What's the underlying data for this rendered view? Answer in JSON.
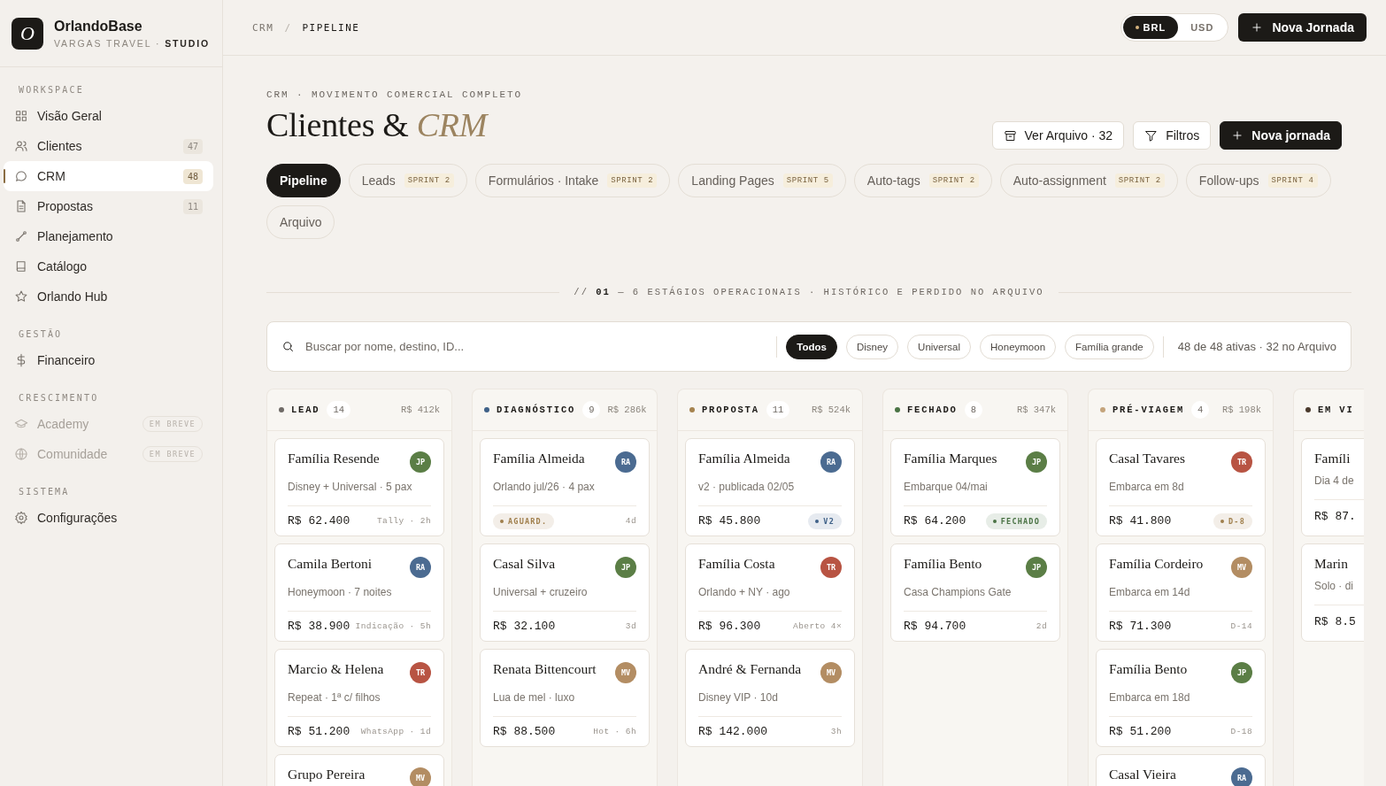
{
  "sidebar": {
    "brand": {
      "logo": "O",
      "name": "OrlandoBase",
      "subtitle": "VARGAS TRAVEL · **STUDIO**"
    },
    "sections": [
      {
        "title": "WORKSPACE",
        "items": [
          {
            "label": "Visão Geral",
            "selected": false,
            "disabled": false
          },
          {
            "label": "Clientes",
            "count": "47",
            "selected": false,
            "disabled": false
          },
          {
            "label": "CRM",
            "count": "48",
            "selected": true,
            "disabled": false
          },
          {
            "label": "Propostas",
            "count": "11",
            "selected": false,
            "disabled": false
          },
          {
            "label": "Planejamento",
            "selected": false,
            "disabled": false
          },
          {
            "label": "Catálogo",
            "selected": false,
            "disabled": false
          },
          {
            "label": "Orlando Hub",
            "selected": false,
            "disabled": false
          }
        ]
      },
      {
        "title": "GESTÃO",
        "items": [
          {
            "label": "Financeiro",
            "selected": false,
            "disabled": false
          }
        ]
      },
      {
        "title": "CRESCIMENTO",
        "items": [
          {
            "label": "Academy",
            "badge": "EM BREVE",
            "selected": false,
            "disabled": true
          },
          {
            "label": "Comunidade",
            "badge": "EM BREVE",
            "selected": false,
            "disabled": true
          }
        ]
      },
      {
        "title": "SISTEMA",
        "items": [
          {
            "label": "Configurações",
            "selected": false,
            "disabled": false
          }
        ]
      }
    ]
  },
  "topbar": {
    "breadcrumb": [
      "CRM",
      "PIPELINE"
    ],
    "separator": "/",
    "currencies": [
      {
        "label": "BRL",
        "selected": true
      },
      {
        "label": "USD",
        "selected": false
      }
    ],
    "action": "Nova Jornada"
  },
  "header": {
    "eyebrow": "CRM · MOVIMENTO COMERCIAL COMPLETO",
    "title": "Clientes & *CRM*",
    "actions": [
      {
        "kind": "archive",
        "label": "Ver Arquivo · 32"
      },
      {
        "kind": "filter",
        "label": "Filtros"
      },
      {
        "kind": "primary",
        "label": "Nova jornada"
      }
    ]
  },
  "tabs": [
    {
      "label": "Pipeline",
      "selected": true
    },
    {
      "label": "Leads",
      "badge": "SPRINT 2",
      "selected": false
    },
    {
      "label": "Formulários · Intake",
      "badge": "SPRINT 2",
      "selected": false
    },
    {
      "label": "Landing Pages",
      "badge": "SPRINT 5",
      "selected": false
    },
    {
      "label": "Auto-tags",
      "badge": "SPRINT 2",
      "selected": false
    },
    {
      "label": "Auto-assignment",
      "badge": "SPRINT 2",
      "selected": false
    },
    {
      "label": "Follow-ups",
      "badge": "SPRINT 4",
      "selected": false
    },
    {
      "label": "Arquivo",
      "selected": false
    }
  ],
  "section_divider": "// **01** — 6 ESTÁGIOS OPERACIONAIS · HISTÓRICO E PERDIDO NO ARQUIVO",
  "filters": {
    "placeholder": "Buscar por nome, destino, ID...",
    "chips": [
      {
        "label": "Todos",
        "selected": true
      },
      {
        "label": "Disney",
        "selected": false
      },
      {
        "label": "Universal",
        "selected": false
      },
      {
        "label": "Honeymoon",
        "selected": false
      },
      {
        "label": "Família grande",
        "selected": false
      }
    ],
    "summary": "48 de 48 ativas · 32 no Arquivo"
  },
  "board": {
    "columns": [
      {
        "name": "LEAD",
        "count": "14",
        "total": "R$ 412k",
        "color": "#6e6a66",
        "cards": [
          {
            "title": "Família Resende",
            "initials": "JP",
            "color": "#5b7e46",
            "subtitle": "Disney + Universal · 5 pax",
            "amount": "R$ 62.400",
            "meta": "Tally · 2h"
          },
          {
            "title": "Camila Bertoni",
            "initials": "RA",
            "color": "#4b6b91",
            "subtitle": "Honeymoon · 7 noites",
            "amount": "R$ 38.900",
            "meta": "Indicação · 5h"
          },
          {
            "title": "Marcio & Helena",
            "initials": "TR",
            "color": "#b85443",
            "subtitle": "Repeat · 1ª c/ filhos",
            "amount": "R$ 51.200",
            "meta": "WhatsApp · 1d"
          },
          {
            "title": "Grupo Pereira",
            "initials": "MV",
            "color": "#b38d63"
          }
        ]
      },
      {
        "name": "DIAGNÓSTICO",
        "count": "9",
        "total": "R$ 286k",
        "color": "#3f6188",
        "cards": [
          {
            "title": "Família Almeida",
            "initials": "RA",
            "color": "#4b6b91",
            "subtitle": "Orlando jul/26 · 4 pax",
            "tag": {
              "label": "AGUARD.",
              "color": "#a07f4c"
            },
            "meta": "4d"
          },
          {
            "title": "Casal Silva",
            "initials": "JP",
            "color": "#5b7e46",
            "subtitle": "Universal + cruzeiro",
            "amount": "R$ 32.100",
            "meta": "3d"
          },
          {
            "title": "Renata Bittencourt",
            "initials": "MV",
            "color": "#b38d63",
            "subtitle": "Lua de mel · luxo",
            "amount": "R$ 88.500",
            "meta": "Hot · 6h"
          }
        ]
      },
      {
        "name": "PROPOSTA",
        "count": "11",
        "total": "R$ 524k",
        "color": "#a5834f",
        "cards": [
          {
            "title": "Família Almeida",
            "initials": "RA",
            "color": "#4b6b91",
            "subtitle": "v2 · publicada 02/05",
            "amount": "R$ 45.800",
            "tag": {
              "label": "V2",
              "color": "#3f6188"
            }
          },
          {
            "title": "Família Costa",
            "initials": "TR",
            "color": "#b85443",
            "subtitle": "Orlando + NY · ago",
            "amount": "R$ 96.300",
            "meta": "Aberto 4×"
          },
          {
            "title": "André & Fernanda",
            "initials": "MV",
            "color": "#b38d63",
            "subtitle": "Disney VIP · 10d",
            "amount": "R$ 142.000",
            "meta": "3h"
          }
        ]
      },
      {
        "name": "FECHADO",
        "count": "8",
        "total": "R$ 347k",
        "color": "#4a7345",
        "cards": [
          {
            "title": "Família Marques",
            "initials": "JP",
            "color": "#5b7e46",
            "subtitle": "Embarque 04/mai",
            "amount": "R$ 64.200",
            "tag": {
              "label": "FECHADO",
              "color": "#4a7345"
            }
          },
          {
            "title": "Família Bento",
            "initials": "JP",
            "color": "#5b7e46",
            "subtitle": "Casa Champions Gate",
            "amount": "R$ 94.700",
            "meta": "2d"
          }
        ]
      },
      {
        "name": "PRÉ-VIAGEM",
        "count": "4",
        "total": "R$ 198k",
        "color": "#c4a47c",
        "cards": [
          {
            "title": "Casal Tavares",
            "initials": "TR",
            "color": "#b85443",
            "subtitle": "Embarca em 8d",
            "amount": "R$ 41.800",
            "tag": {
              "label": "D-8",
              "color": "#a07f4c"
            }
          },
          {
            "title": "Família Cordeiro",
            "initials": "MV",
            "color": "#b38d63",
            "subtitle": "Embarca em 14d",
            "amount": "R$ 71.300",
            "meta": "D-14"
          },
          {
            "title": "Família Bento",
            "initials": "JP",
            "color": "#5b7e46",
            "subtitle": "Embarca em 18d",
            "amount": "R$ 51.200",
            "meta": "D-18"
          },
          {
            "title": "Casal Vieira",
            "initials": "RA",
            "color": "#4b6b91"
          }
        ]
      },
      {
        "name": "EM VI",
        "color": "#4a3a2c",
        "cards": [
          {
            "title": "Famíli",
            "subtitle": "Dia 4 de",
            "amount": "R$ 87."
          },
          {
            "title": "Marin",
            "subtitle": "Solo · di",
            "amount": "R$ 8.5"
          }
        ]
      }
    ]
  }
}
